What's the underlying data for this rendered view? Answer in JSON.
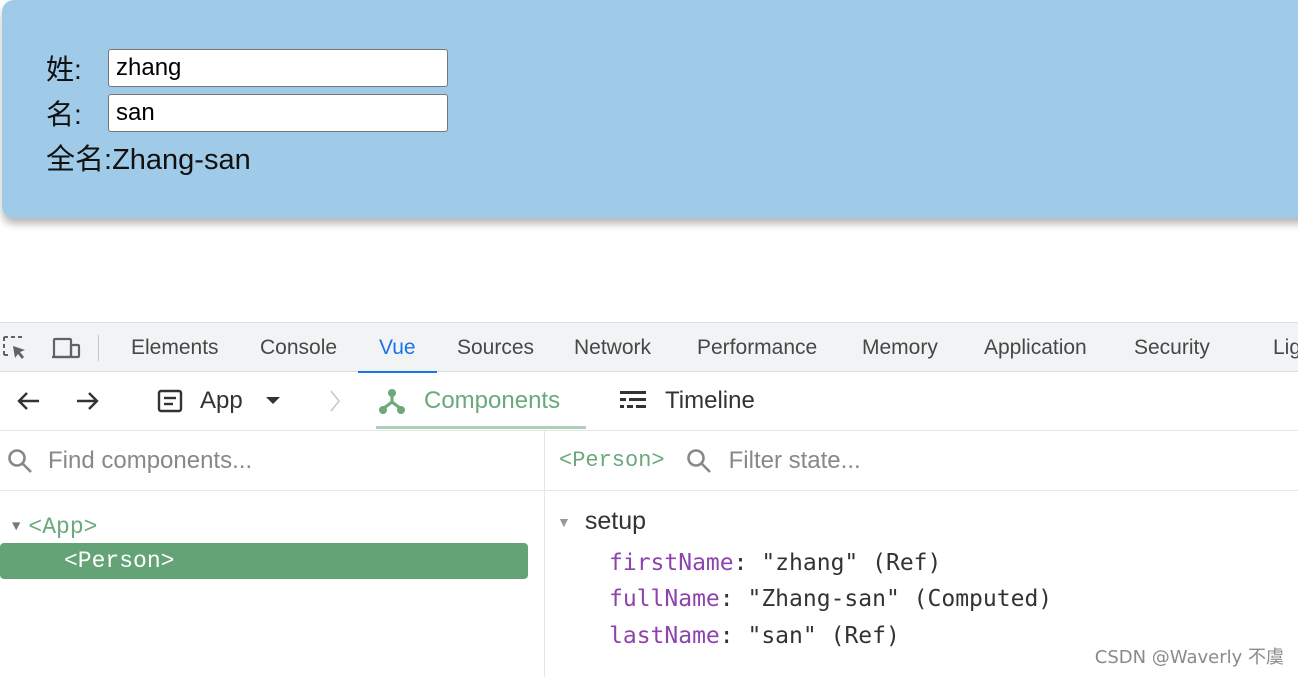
{
  "page": {
    "first_label": "姓:",
    "first_value": "zhang",
    "last_label": "名:",
    "last_value": "san",
    "full_label": "全名:",
    "full_value": "Zhang-san"
  },
  "devtools": {
    "tabs": [
      "Elements",
      "Console",
      "Vue",
      "Sources",
      "Network",
      "Performance",
      "Memory",
      "Application",
      "Security",
      "Lig"
    ],
    "active_tab": "Vue"
  },
  "vue": {
    "app_label": "App",
    "components_label": "Components",
    "timeline_label": "Timeline",
    "find_placeholder": "Find components...",
    "tree": {
      "root": "<App>",
      "child": "<Person>"
    },
    "selected_tag": "<Person>",
    "filter_placeholder": "Filter state...",
    "section": "setup",
    "state": [
      {
        "key": "firstName",
        "value": "\"zhang\"",
        "type": "(Ref)"
      },
      {
        "key": "fullName",
        "value": "\"Zhang-san\"",
        "type": "(Computed)"
      },
      {
        "key": "lastName",
        "value": "\"san\"",
        "type": "(Ref)"
      }
    ]
  },
  "watermark": "CSDN @Waverly 不虞",
  "colors": {
    "card_bg": "#9fcbe8",
    "vue_green": "#6aa97c",
    "selected_row": "#63a375",
    "accent_blue": "#1a73e8",
    "state_key": "#8e44ad"
  }
}
